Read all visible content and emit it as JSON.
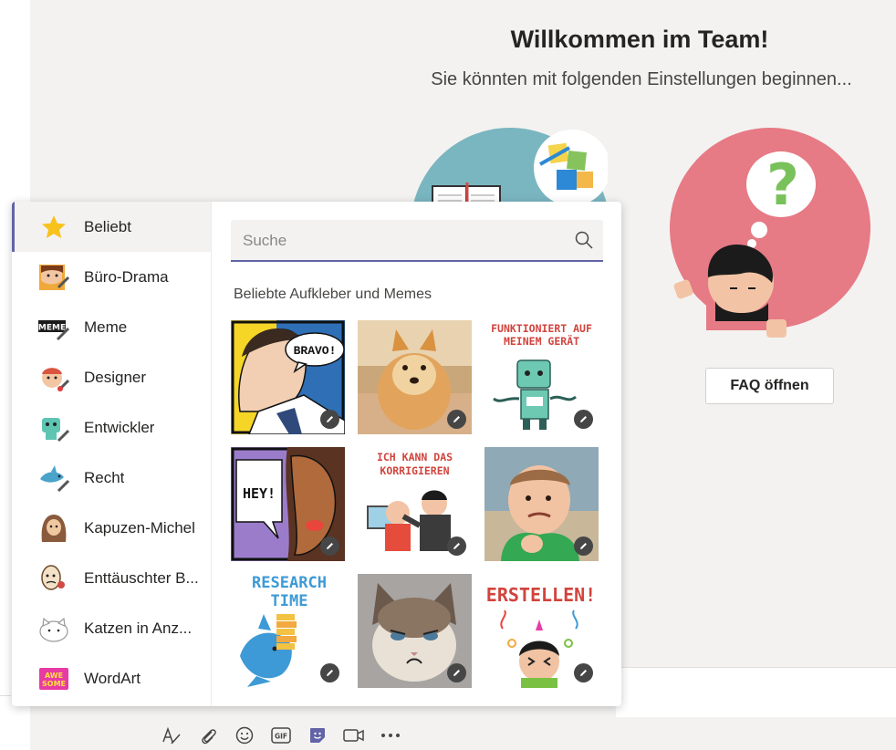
{
  "welcome": {
    "title": "Willkommen im Team!",
    "subtitle": "Sie könnten mit folgenden Einstellungen beginnen..."
  },
  "faq_button": "FAQ öffnen",
  "sticker_picker": {
    "categories": [
      {
        "label": "Beliebt",
        "icon": "star-icon",
        "active": true
      },
      {
        "label": "Büro-Drama",
        "icon": "office-drama-icon"
      },
      {
        "label": "Meme",
        "icon": "meme-icon"
      },
      {
        "label": "Designer",
        "icon": "designer-icon"
      },
      {
        "label": "Entwickler",
        "icon": "developer-icon"
      },
      {
        "label": "Recht",
        "icon": "legal-shark-icon"
      },
      {
        "label": "Kapuzen-Michel",
        "icon": "hooded-character-icon"
      },
      {
        "label": "Enttäuschter B...",
        "icon": "disappointed-character-icon"
      },
      {
        "label": "Katzen in Anz...",
        "icon": "cat-in-suit-icon"
      },
      {
        "label": "WordArt",
        "icon": "wordart-icon"
      }
    ],
    "search_placeholder": "Suche",
    "section_heading": "Beliebte Aufkleber und Memes",
    "stickers": [
      {
        "name": "bravo-comic-sticker",
        "text": "BRAVO!"
      },
      {
        "name": "doge-meme-sticker",
        "text": ""
      },
      {
        "name": "works-on-my-machine-sticker",
        "text": "FUNKTIONIERT AUF MEINEM GERÄT"
      },
      {
        "name": "hey-comic-sticker",
        "text": "HEY!"
      },
      {
        "name": "i-can-fix-that-sticker",
        "text": "ICH KANN DAS KORRIGIEREN"
      },
      {
        "name": "success-kid-meme-sticker",
        "text": ""
      },
      {
        "name": "research-time-sticker",
        "text": "RESEARCH TIME"
      },
      {
        "name": "grumpy-cat-meme-sticker",
        "text": ""
      },
      {
        "name": "create-sticker",
        "text": "ERSTELLEN!"
      }
    ]
  },
  "compose_toolbar": [
    "format-icon",
    "attach-icon",
    "emoji-icon",
    "gif-icon",
    "sticker-icon",
    "meet-now-icon",
    "more-options-icon"
  ],
  "colors": {
    "accent": "#6264a7",
    "background": "#f3f2f1",
    "illustration_teal": "#7ab6c0",
    "illustration_pink": "#e67a85",
    "question_green": "#79c15a"
  }
}
